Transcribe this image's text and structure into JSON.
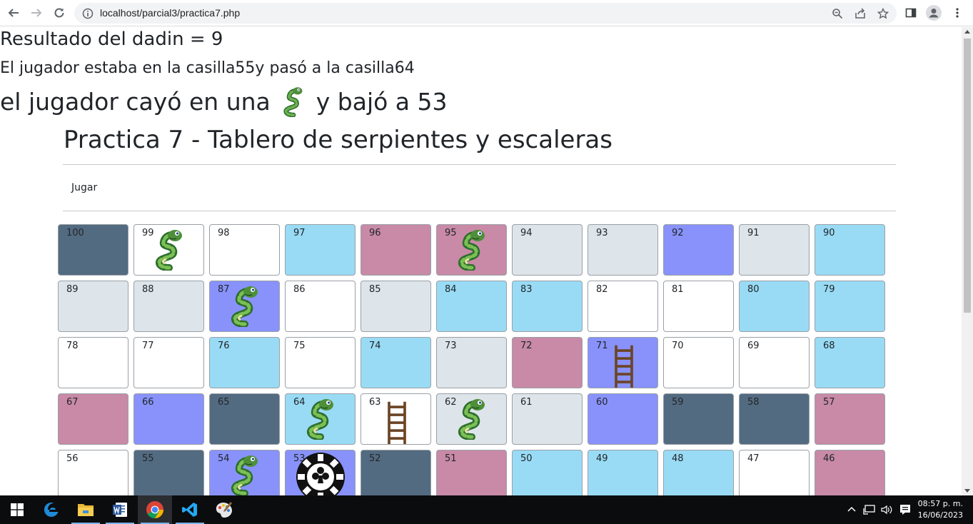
{
  "browser": {
    "url": "localhost/parcial3/practica7.php"
  },
  "messages": {
    "dice_result": "Resultado del dadin = 9",
    "moved": "El jugador estaba en la casilla55y pasó a la casilla64",
    "snake_prefix": "el jugador cayó en una",
    "snake_suffix": "y bajó a 53"
  },
  "page": {
    "title": "Practica 7 - Tablero de serpientes y escaleras",
    "play_link": "Jugar"
  },
  "board": {
    "rows": [
      [
        {
          "n": "100",
          "color": "dark"
        },
        {
          "n": "99",
          "color": "white",
          "piece": "snake"
        },
        {
          "n": "98",
          "color": "white"
        },
        {
          "n": "97",
          "color": "cyan"
        },
        {
          "n": "96",
          "color": "pink"
        },
        {
          "n": "95",
          "color": "pink",
          "piece": "snake"
        },
        {
          "n": "94",
          "color": "gray"
        },
        {
          "n": "93",
          "color": "gray"
        },
        {
          "n": "92",
          "color": "purple"
        },
        {
          "n": "91",
          "color": "gray"
        },
        {
          "n": "90",
          "color": "cyan"
        }
      ],
      [
        {
          "n": "89",
          "color": "gray"
        },
        {
          "n": "88",
          "color": "gray"
        },
        {
          "n": "87",
          "color": "purple",
          "piece": "snake"
        },
        {
          "n": "86",
          "color": "white"
        },
        {
          "n": "85",
          "color": "gray"
        },
        {
          "n": "84",
          "color": "cyan"
        },
        {
          "n": "83",
          "color": "cyan"
        },
        {
          "n": "82",
          "color": "white"
        },
        {
          "n": "81",
          "color": "white"
        },
        {
          "n": "80",
          "color": "cyan"
        },
        {
          "n": "79",
          "color": "cyan"
        }
      ],
      [
        {
          "n": "78",
          "color": "white"
        },
        {
          "n": "77",
          "color": "white"
        },
        {
          "n": "76",
          "color": "cyan"
        },
        {
          "n": "75",
          "color": "white"
        },
        {
          "n": "74",
          "color": "cyan"
        },
        {
          "n": "73",
          "color": "gray"
        },
        {
          "n": "72",
          "color": "pink"
        },
        {
          "n": "71",
          "color": "purple",
          "piece": "ladder"
        },
        {
          "n": "70",
          "color": "white"
        },
        {
          "n": "69",
          "color": "white"
        },
        {
          "n": "68",
          "color": "cyan"
        }
      ],
      [
        {
          "n": "67",
          "color": "pink"
        },
        {
          "n": "66",
          "color": "purple"
        },
        {
          "n": "65",
          "color": "dark"
        },
        {
          "n": "64",
          "color": "cyan",
          "piece": "snake"
        },
        {
          "n": "63",
          "color": "white",
          "piece": "ladder"
        },
        {
          "n": "62",
          "color": "gray",
          "piece": "snake"
        },
        {
          "n": "61",
          "color": "gray"
        },
        {
          "n": "60",
          "color": "purple"
        },
        {
          "n": "59",
          "color": "dark"
        },
        {
          "n": "58",
          "color": "dark"
        },
        {
          "n": "57",
          "color": "pink"
        }
      ],
      [
        {
          "n": "56",
          "color": "white"
        },
        {
          "n": "55",
          "color": "dark"
        },
        {
          "n": "54",
          "color": "purple",
          "piece": "snake"
        },
        {
          "n": "53",
          "color": "purple",
          "piece": "chip"
        },
        {
          "n": "52",
          "color": "dark"
        },
        {
          "n": "51",
          "color": "pink"
        },
        {
          "n": "50",
          "color": "cyan"
        },
        {
          "n": "49",
          "color": "cyan"
        },
        {
          "n": "48",
          "color": "cyan"
        },
        {
          "n": "47",
          "color": "white"
        },
        {
          "n": "46",
          "color": "pink"
        }
      ]
    ]
  },
  "taskbar": {
    "apps": [
      "windows-start",
      "edge",
      "file-explorer",
      "word",
      "chrome",
      "vscode",
      "paint"
    ],
    "time": "08:57 p. m.",
    "date": "16/06/2023"
  }
}
